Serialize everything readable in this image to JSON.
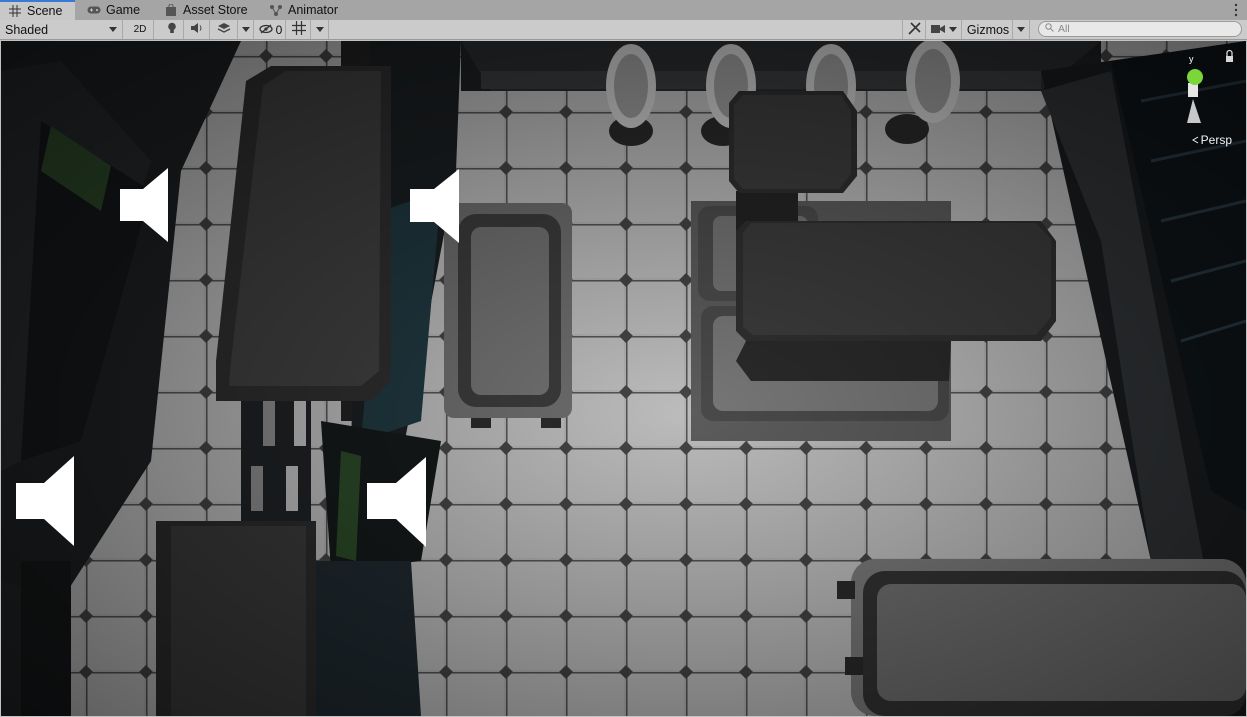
{
  "tabs": [
    {
      "label": "Scene",
      "icon": "grid-icon"
    },
    {
      "label": "Game",
      "icon": "gamepad-icon"
    },
    {
      "label": "Asset Store",
      "icon": "shopping-bag-icon"
    },
    {
      "label": "Animator",
      "icon": "animator-icon"
    }
  ],
  "toolbar": {
    "draw_mode": "Shaded",
    "mode_2d": "2D",
    "hidden_count": "0",
    "gizmos_label": "Gizmos",
    "search_placeholder": "All"
  },
  "gizmo": {
    "projection": "Persp",
    "axis_y": "y"
  },
  "colors": {
    "active_tab_accent": "#3a79d6",
    "gizmo_y_axis": "#7ad63a",
    "floor_tile": "#b8b8b8",
    "wall_dark": "#1e2022"
  }
}
